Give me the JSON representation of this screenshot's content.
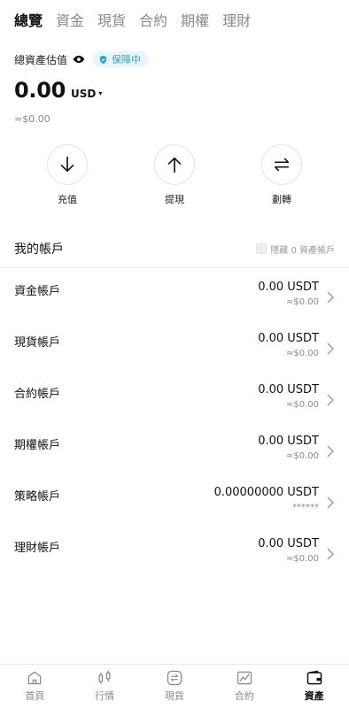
{
  "tabs": [
    {
      "label": "總覽",
      "active": true
    },
    {
      "label": "資金",
      "active": false
    },
    {
      "label": "現貨",
      "active": false
    },
    {
      "label": "合約",
      "active": false
    },
    {
      "label": "期權",
      "active": false
    },
    {
      "label": "理財",
      "active": false
    }
  ],
  "summary": {
    "label": "總資產估值",
    "badge": "保障中",
    "balance": "0.00",
    "currency": "USD",
    "caret": "▾",
    "approx": "≈$0.00"
  },
  "actions": [
    {
      "label": "充值",
      "icon": "arrow-down-icon"
    },
    {
      "label": "提現",
      "icon": "arrow-up-icon"
    },
    {
      "label": "劃轉",
      "icon": "transfer-icon"
    }
  ],
  "accounts_section": {
    "title": "我的帳戶",
    "hide_zero_label": "隱藏 0 資產帳戶"
  },
  "accounts": [
    {
      "name": "資金帳戶",
      "amount": "0.00 USDT",
      "sub": "≈$0.00"
    },
    {
      "name": "現貨帳戶",
      "amount": "0.00 USDT",
      "sub": "≈$0.00"
    },
    {
      "name": "合約帳戶",
      "amount": "0.00 USDT",
      "sub": "≈$0.00"
    },
    {
      "name": "期權帳戶",
      "amount": "0.00 USDT",
      "sub": "≈$0.00"
    },
    {
      "name": "策略帳戶",
      "amount": "0.00000000 USDT",
      "sub": "******"
    },
    {
      "name": "理財帳戶",
      "amount": "0.00 USDT",
      "sub": "≈$0.00"
    }
  ],
  "bottom_nav": [
    {
      "label": "首頁",
      "icon": "home-icon",
      "active": false
    },
    {
      "label": "行情",
      "icon": "candlestick-icon",
      "active": false
    },
    {
      "label": "現貨",
      "icon": "spot-icon",
      "active": false
    },
    {
      "label": "合約",
      "icon": "futures-icon",
      "active": false
    },
    {
      "label": "資產",
      "icon": "wallet-icon",
      "active": true
    }
  ],
  "colors": {
    "accent": "#2aa5c8",
    "badge_bg": "#e8f5fa",
    "text_primary": "#111111",
    "text_secondary": "#8a8a8a"
  }
}
